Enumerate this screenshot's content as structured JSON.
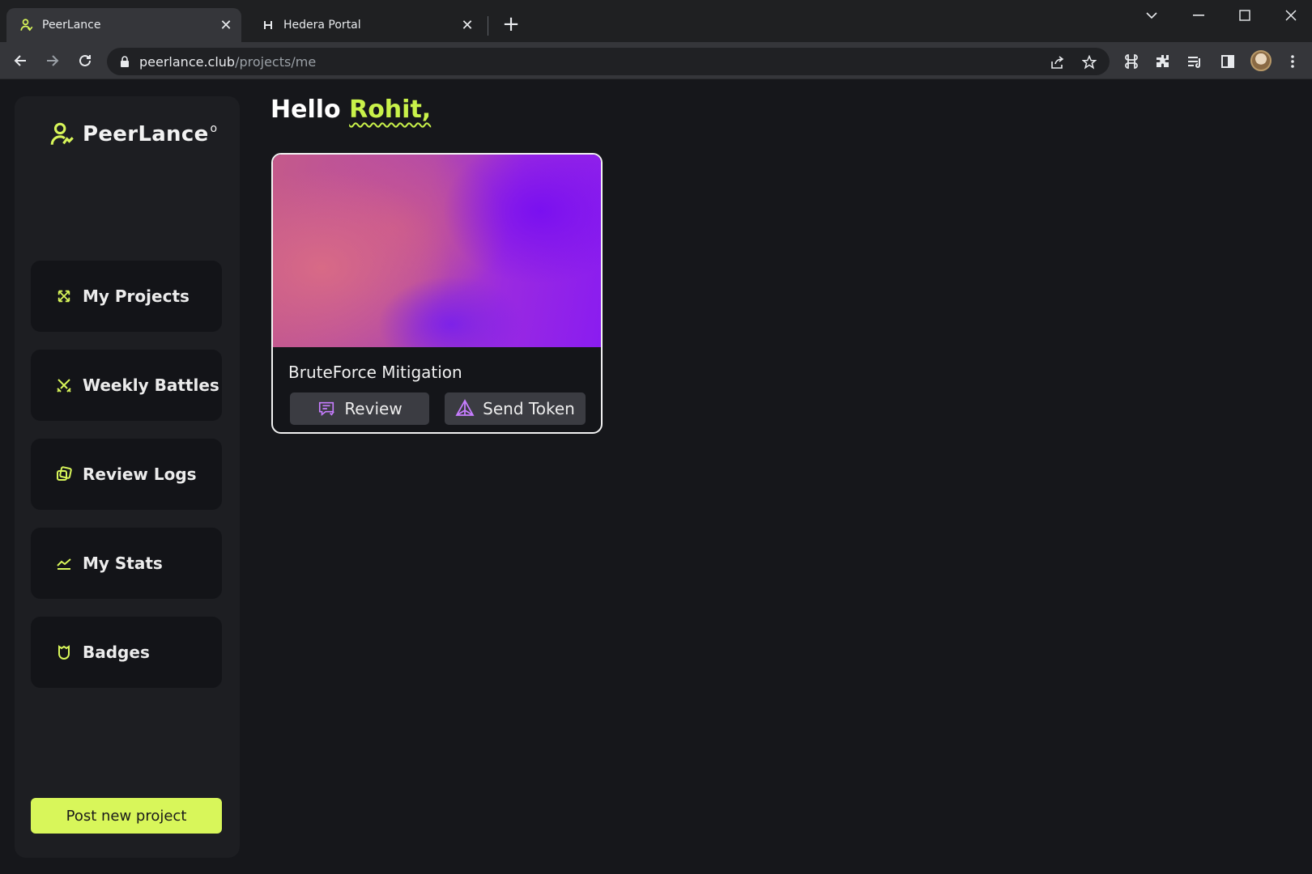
{
  "browser": {
    "tabs": [
      {
        "title": "PeerLance",
        "favicon": "peerlance-icon",
        "active": true
      },
      {
        "title": "Hedera Portal",
        "favicon": "hedera-icon",
        "active": false
      }
    ],
    "url_domain": "peerlance.club",
    "url_path": "/projects/me"
  },
  "brand": {
    "name": "PeerLance",
    "accent_color": "#d8f65a"
  },
  "sidebar": {
    "items": [
      {
        "label": "My Projects",
        "icon": "projects-icon"
      },
      {
        "label": "Weekly Battles",
        "icon": "battles-icon"
      },
      {
        "label": "Review Logs",
        "icon": "review-logs-icon"
      },
      {
        "label": "My Stats",
        "icon": "stats-icon"
      },
      {
        "label": "Badges",
        "icon": "badge-icon"
      }
    ],
    "post_button": "Post new project"
  },
  "main": {
    "greeting_prefix": "Hello",
    "greeting_name": "Rohit,",
    "project": {
      "title": "BruteForce Mitigation",
      "review_label": "Review",
      "send_token_label": "Send Token"
    }
  }
}
